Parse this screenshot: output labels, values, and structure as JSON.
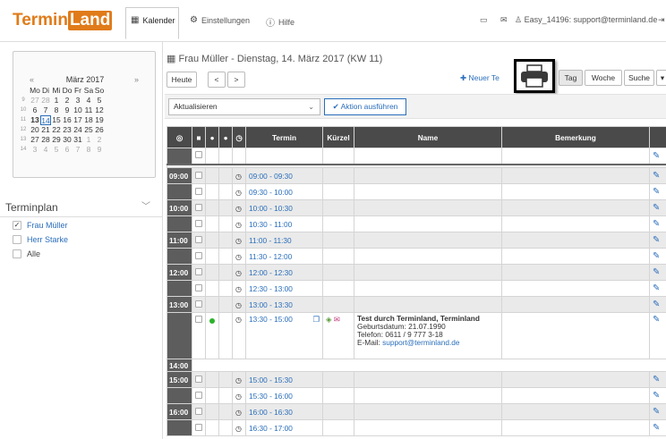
{
  "topbar": {
    "logo_a": "Termin",
    "logo_b": "Land",
    "nav": [
      {
        "label": "Kalender",
        "icon": "calendar-icon"
      },
      {
        "label": "Einstellungen",
        "icon": "gear-icon"
      },
      {
        "label": "Hilfe",
        "icon": "help-icon"
      }
    ],
    "account": "Easy_14196: support@terminland.de"
  },
  "minical": {
    "prev": "«",
    "next": "»",
    "title": "März 2017",
    "weekdays": [
      "Mo",
      "Di",
      "Mi",
      "Do",
      "Fr",
      "Sa",
      "So"
    ],
    "weeks": [
      {
        "wk": "9",
        "days": [
          "27",
          "28",
          "1",
          "2",
          "3",
          "4",
          "5"
        ]
      },
      {
        "wk": "10",
        "days": [
          "6",
          "7",
          "8",
          "9",
          "10",
          "11",
          "12"
        ]
      },
      {
        "wk": "11",
        "days": [
          "13",
          "14",
          "15",
          "16",
          "17",
          "18",
          "19"
        ]
      },
      {
        "wk": "12",
        "days": [
          "20",
          "21",
          "22",
          "23",
          "24",
          "25",
          "26"
        ]
      },
      {
        "wk": "13",
        "days": [
          "27",
          "28",
          "29",
          "30",
          "31",
          "1",
          "2"
        ]
      },
      {
        "wk": "14",
        "days": [
          "3",
          "4",
          "5",
          "6",
          "7",
          "8",
          "9"
        ]
      }
    ]
  },
  "terminplan": {
    "title": "Terminplan",
    "items": [
      {
        "label": "Frau Müller",
        "checked": true
      },
      {
        "label": "Herr Starke",
        "checked": false
      },
      {
        "label": "Alle",
        "checked": false
      }
    ]
  },
  "main": {
    "title": "Frau Müller - Dienstag, 14. März 2017 (KW 11)",
    "today": "Heute",
    "prev": "<",
    "next": ">",
    "new": "Neuer Te",
    "views": [
      "Tag",
      "Woche",
      "Suche"
    ],
    "action_select": "Aktualisieren",
    "action_button": "Aktion ausführen"
  },
  "grid": {
    "headers": [
      "Termin",
      "Kürzel",
      "Name",
      "Bemerkung"
    ],
    "rows": [
      {
        "hour": "",
        "time": "",
        "sep": false,
        "empty": true
      },
      {
        "hour": "09:00",
        "time": "09:00 - 09:30"
      },
      {
        "hour": "",
        "time": "09:30 - 10:00"
      },
      {
        "hour": "10:00",
        "time": "10:00 - 10:30"
      },
      {
        "hour": "",
        "time": "10:30 - 11:00"
      },
      {
        "hour": "11:00",
        "time": "11:00 - 11:30"
      },
      {
        "hour": "",
        "time": "11:30 - 12:00"
      },
      {
        "hour": "12:00",
        "time": "12:00 - 12:30"
      },
      {
        "hour": "",
        "time": "12:30 - 13:00"
      },
      {
        "hour": "13:00",
        "time": "13:00 - 13:30"
      }
    ],
    "appointment": {
      "time": "13:30 - 15:00",
      "name": "Test durch Terminland, Terminland",
      "birth": "Geburtsdatum: 21.07.1990",
      "phone": "Telefon: 0611 / 9 777 3-18",
      "email_label": "E-Mail: ",
      "email": "support@terminland.de"
    },
    "row_1400": "14:00",
    "after": [
      {
        "hour": "15:00",
        "time": "15:00 - 15:30"
      },
      {
        "hour": "",
        "time": "15:30 - 16:00"
      },
      {
        "hour": "16:00",
        "time": "16:00 - 16:30"
      },
      {
        "hour": "",
        "time": "16:30 - 17:00"
      }
    ]
  }
}
